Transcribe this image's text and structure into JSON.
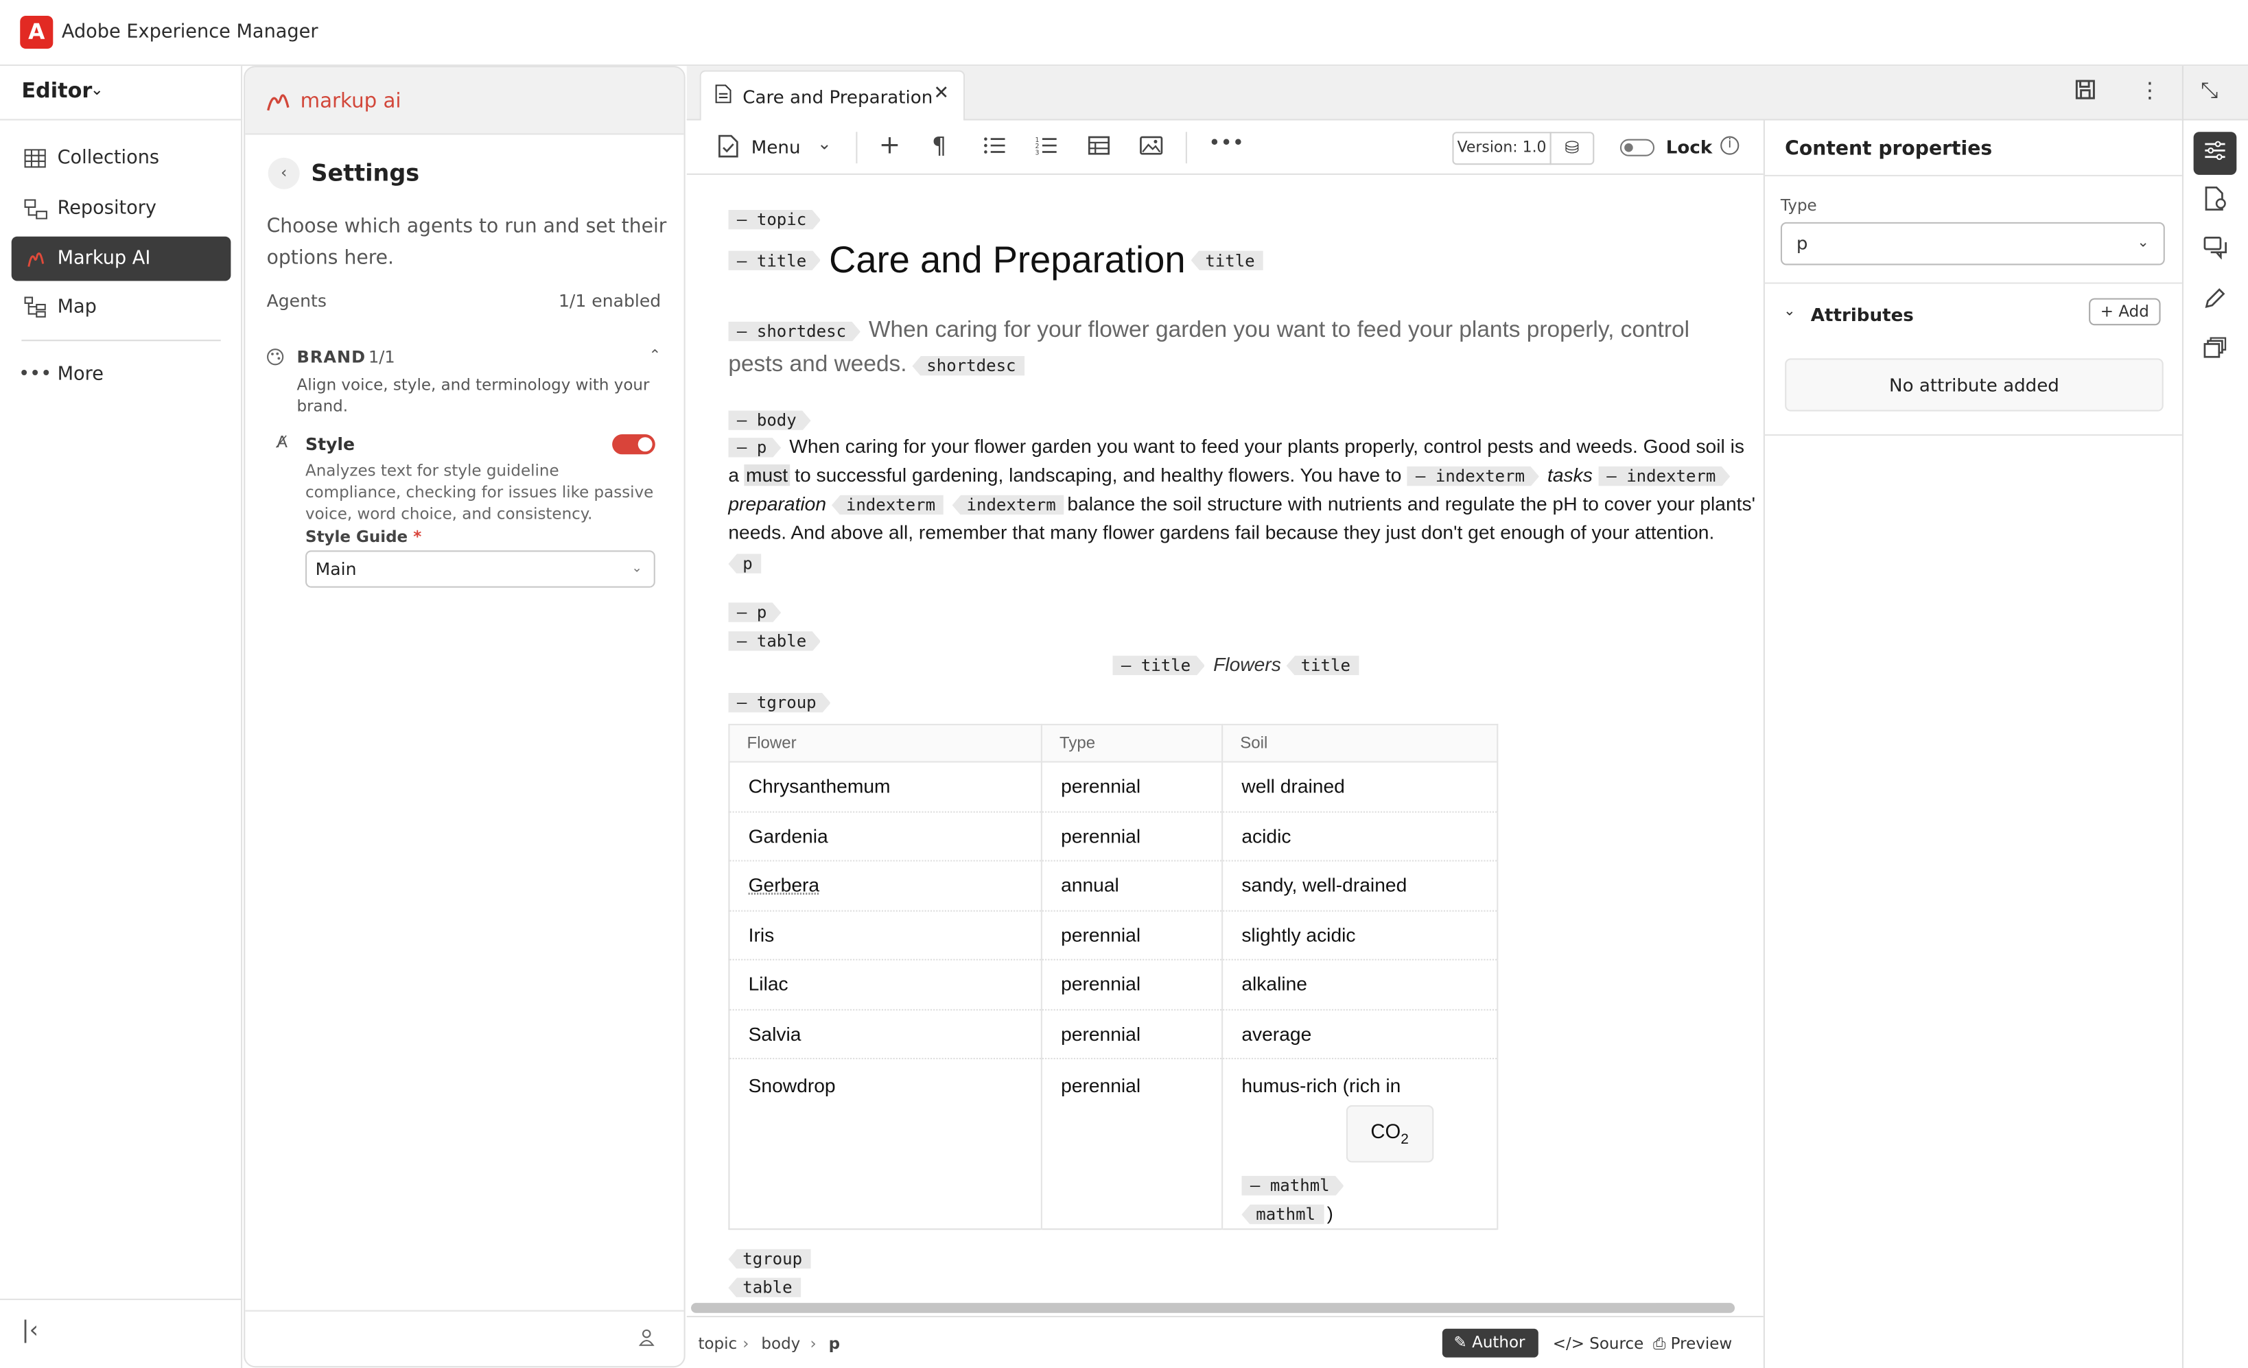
{
  "app": {
    "title": "Adobe Experience Manager",
    "logo_letter": "A"
  },
  "leftnav": {
    "editor_label": "Editor",
    "items": [
      {
        "label": "Collections",
        "icon": "table-icon"
      },
      {
        "label": "Repository",
        "icon": "folder-tree-icon"
      },
      {
        "label": "Markup AI",
        "icon": "markup-ai-icon",
        "active": true
      },
      {
        "label": "Map",
        "icon": "map-icon"
      }
    ],
    "more_label": "More"
  },
  "markup": {
    "brand": "markup ai",
    "settings_title": "Settings",
    "settings_desc": "Choose which agents to run and set their options here.",
    "agents_label": "Agents",
    "agents_count": "1/1 enabled",
    "brand_label": "BRAND",
    "brand_count": "1/1",
    "brand_desc": "Align voice, style, and terminology with your brand.",
    "style_label": "Style",
    "style_enabled": true,
    "style_desc": "Analyzes text for style guideline compliance, checking for issues like passive voice, word choice, and consistency.",
    "style_guide_label": "Style Guide",
    "style_guide_required": "*",
    "style_guide_value": "Main"
  },
  "editor": {
    "tab_title": "Care and Preparation",
    "toolbar_menu": "Menu",
    "version": "Version: 1.0",
    "lock_label": "Lock"
  },
  "doc": {
    "tags": {
      "topic": "topic",
      "title": "title",
      "shortdesc": "shortdesc",
      "body": "body",
      "p": "p",
      "indexterm": "indexterm",
      "table": "table",
      "tgroup": "tgroup",
      "mathml": "mathml"
    },
    "title": "Care and Preparation",
    "shortdesc_1": "When caring for your flower garden you want to feed your plants properly, control",
    "shortdesc_2": "pests and weeds.",
    "p1_line1": "When caring for your flower garden you want to feed your plants properly, control pests and weeds. Good soil is",
    "p1_line2a": "a",
    "p1_must": "must",
    "p1_line2b": "to successful gardening, landscaping, and healthy flowers. You have to",
    "p1_tasks": "tasks",
    "p1_preparation": "preparation",
    "p1_line3b": "balance the soil structure with nutrients and regulate the pH to cover your plants'",
    "p1_line4": "needs. And above all, remember that many flower gardens fail because they just don't get enough of your attention.",
    "table_title": "Flowers",
    "columns": [
      "Flower",
      "Type",
      "Soil"
    ],
    "rows": [
      [
        "Chrysanthemum",
        "perennial",
        "well drained"
      ],
      [
        "Gardenia",
        "perennial",
        "acidic"
      ],
      [
        "Gerbera",
        "annual",
        "sandy, well-drained"
      ],
      [
        "Iris",
        "perennial",
        "slightly acidic"
      ],
      [
        "Lilac",
        "perennial",
        "alkaline"
      ],
      [
        "Salvia",
        "perennial",
        "average"
      ],
      [
        "Snowdrop",
        "perennial",
        "humus-rich (rich in"
      ]
    ],
    "co2_base": "CO",
    "co2_sub": "2",
    "paren_close": ")"
  },
  "statusbar": {
    "breadcrumb": [
      "topic",
      "body",
      "p"
    ],
    "author": "Author",
    "source": "Source",
    "preview": "Preview"
  },
  "props": {
    "title": "Content properties",
    "type_label": "Type",
    "type_value": "p",
    "attributes_label": "Attributes",
    "add_label": "Add",
    "no_attr": "No attribute added"
  },
  "colors": {
    "accent": "#e22a23",
    "dark": "#3c3c3c",
    "toggle_on": "#d9443a"
  }
}
